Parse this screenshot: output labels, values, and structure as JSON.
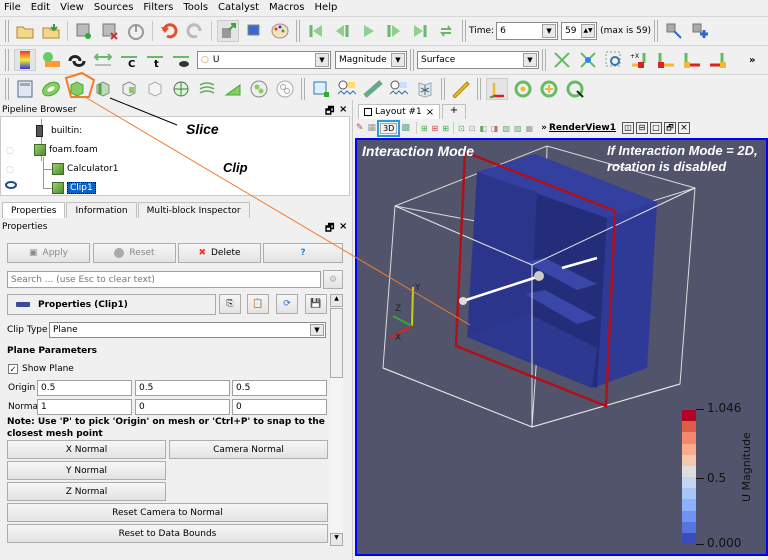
{
  "menu": [
    "File",
    "Edit",
    "View",
    "Sources",
    "Filters",
    "Tools",
    "Catalyst",
    "Macros",
    "Help"
  ],
  "time_toolbar": {
    "time_label": "Time:",
    "time_value": "6",
    "step_value": "59",
    "max_label": "(max is 59)"
  },
  "color_toolbar": {
    "array_value": "U",
    "component_value": "Magnitude",
    "representation_value": "Surface",
    "more": "»"
  },
  "camera_buttons": [
    "+X",
    "-X",
    "+Y",
    "-Y"
  ],
  "pipeline": {
    "title": "Pipeline Browser",
    "items": [
      {
        "label": "builtin:"
      },
      {
        "label": "foam.foam"
      },
      {
        "label": "Calculator1"
      },
      {
        "label": "Clip1"
      }
    ]
  },
  "tabs": [
    "Properties",
    "Information",
    "Multi-block Inspector"
  ],
  "properties": {
    "title": "Properties",
    "apply": "Apply",
    "reset": "Reset",
    "delete": "Delete",
    "help": "?",
    "search_placeholder": "Search ... (use Esc to clear text)",
    "section": "Properties (Clip1)",
    "clip_type_label": "Clip Type",
    "clip_type_value": "Plane",
    "plane_params": "Plane Parameters",
    "show_plane": "Show Plane",
    "origin_label": "Origin",
    "origin": [
      "0.5",
      "0.5",
      "0.5"
    ],
    "normal_label": "Normal",
    "normal": [
      "1",
      "0",
      "0"
    ],
    "note": "Note: Use 'P' to pick 'Origin' on mesh or 'Ctrl+P' to snap to the closest mesh point",
    "x_normal": "X Normal",
    "camera_normal": "Camera Normal",
    "y_normal": "Y Normal",
    "z_normal": "Z Normal",
    "reset_camera": "Reset Camera to Normal",
    "reset_bounds": "Reset to Data Bounds"
  },
  "layout": {
    "tab": "Layout #1",
    "close": "×",
    "add": "+",
    "mode": "3D",
    "view_name": "RenderView1",
    "more": "»"
  },
  "annotations": {
    "slice": "Slice",
    "clip": "Clip",
    "interaction": "Interaction Mode",
    "note_line1": "If Interaction Mode = 2D,",
    "note_line2": "rotation is disabled"
  },
  "colorbar": {
    "title": "U Magnitude",
    "max": "1.046",
    "mid": "0.5",
    "min": "0.000",
    "colors": [
      "#b40426",
      "#dd5d48",
      "#f08a6c",
      "#f7ac8c",
      "#f3c8b0",
      "#dddddd",
      "#c5d6f2",
      "#a8c4f8",
      "#8caffe",
      "#6f92f3",
      "#5673e0",
      "#3b4cc0"
    ]
  },
  "axes": {
    "x": "X",
    "y": "Y",
    "z": "Z"
  }
}
